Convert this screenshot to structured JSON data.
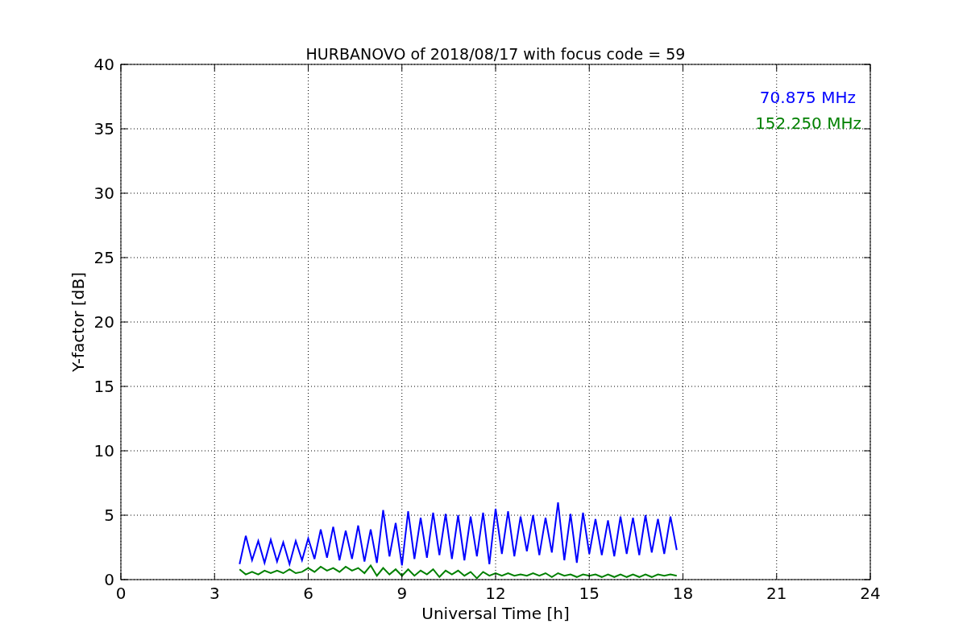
{
  "chart_data": {
    "type": "line",
    "title": "HURBANOVO of 2018/08/17 with focus code = 59",
    "xlabel": "Universal Time [h]",
    "ylabel": "Y-factor [dB]",
    "x": [
      3.8,
      4.0,
      4.2,
      4.4,
      4.6,
      4.8,
      5.0,
      5.2,
      5.4,
      5.6,
      5.8,
      6.0,
      6.2,
      6.4,
      6.6,
      6.8,
      7.0,
      7.2,
      7.4,
      7.6,
      7.8,
      8.0,
      8.2,
      8.4,
      8.6,
      8.8,
      9.0,
      9.2,
      9.4,
      9.6,
      9.8,
      10.0,
      10.2,
      10.4,
      10.6,
      10.8,
      11.0,
      11.2,
      11.4,
      11.6,
      11.8,
      12.0,
      12.2,
      12.4,
      12.6,
      12.8,
      13.0,
      13.2,
      13.4,
      13.6,
      13.8,
      14.0,
      14.2,
      14.4,
      14.6,
      14.8,
      15.0,
      15.2,
      15.4,
      15.6,
      15.8,
      16.0,
      16.2,
      16.4,
      16.6,
      16.8,
      17.0,
      17.2,
      17.4,
      17.6,
      17.8
    ],
    "series": [
      {
        "name": "70.875 MHz",
        "color": "#0000ff",
        "values": [
          1.2,
          3.4,
          1.5,
          3.0,
          1.3,
          3.1,
          1.4,
          2.9,
          1.2,
          3.0,
          1.5,
          3.2,
          1.6,
          3.9,
          1.7,
          4.1,
          1.5,
          3.8,
          1.6,
          4.2,
          1.4,
          3.9,
          1.3,
          5.4,
          1.8,
          4.4,
          1.1,
          5.3,
          1.6,
          4.8,
          1.7,
          5.2,
          1.9,
          5.1,
          1.6,
          5.0,
          1.5,
          4.9,
          1.8,
          5.2,
          1.2,
          5.5,
          2.0,
          5.3,
          1.8,
          4.9,
          2.2,
          5.0,
          1.9,
          4.8,
          2.1,
          6.0,
          1.5,
          5.1,
          1.3,
          5.2,
          2.0,
          4.7,
          1.9,
          4.6,
          1.8,
          4.9,
          2.0,
          4.8,
          1.9,
          5.0,
          2.1,
          4.7,
          2.0,
          4.9,
          2.3
        ]
      },
      {
        "name": "152.250 MHz",
        "color": "#008000",
        "values": [
          0.8,
          0.4,
          0.6,
          0.4,
          0.7,
          0.5,
          0.7,
          0.5,
          0.8,
          0.5,
          0.6,
          0.9,
          0.6,
          1.0,
          0.7,
          0.9,
          0.6,
          1.0,
          0.7,
          0.9,
          0.5,
          1.1,
          0.3,
          0.9,
          0.4,
          0.8,
          0.3,
          0.8,
          0.3,
          0.7,
          0.4,
          0.8,
          0.2,
          0.7,
          0.4,
          0.7,
          0.3,
          0.6,
          0.1,
          0.6,
          0.3,
          0.5,
          0.3,
          0.5,
          0.3,
          0.4,
          0.3,
          0.5,
          0.3,
          0.5,
          0.2,
          0.5,
          0.3,
          0.4,
          0.2,
          0.4,
          0.3,
          0.4,
          0.2,
          0.4,
          0.2,
          0.4,
          0.2,
          0.4,
          0.2,
          0.4,
          0.2,
          0.4,
          0.3,
          0.4,
          0.3
        ]
      }
    ],
    "grid": true,
    "xlim": [
      0,
      24
    ],
    "ylim": [
      0,
      40
    ],
    "xticks": [
      0,
      3,
      6,
      9,
      12,
      15,
      18,
      21,
      24
    ],
    "yticks": [
      0,
      5,
      10,
      15,
      20,
      25,
      30,
      35,
      40
    ]
  }
}
